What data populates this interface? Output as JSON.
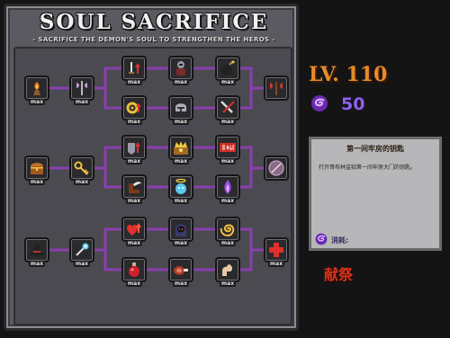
{
  "panel": {
    "title": "SOUL SACRIFICE",
    "subtitle": "- SACRIFICE THE DEMON'S SOUL TO STRENGTHEN THE HEROS -"
  },
  "tree": {
    "nodes": [
      {
        "id": "g1a",
        "icon": "brazier-icon",
        "badge": "max"
      },
      {
        "id": "g1b",
        "icon": "double-axe-icon",
        "badge": "max"
      },
      {
        "id": "g1c",
        "icon": "sword-up-icon",
        "badge": "max"
      },
      {
        "id": "g1d",
        "icon": "armored-knight-icon",
        "badge": "max"
      },
      {
        "id": "g1e",
        "icon": "bomb-icon",
        "badge": "max"
      },
      {
        "id": "g1f",
        "icon": "gear-up-icon",
        "badge": "max"
      },
      {
        "id": "g1g",
        "icon": "helmet-icon",
        "badge": "max"
      },
      {
        "id": "g1h",
        "icon": "crossed-blades-icon",
        "badge": "max"
      },
      {
        "id": "g1i",
        "icon": "battle-axe-icon",
        "badge": "max"
      },
      {
        "id": "g2a",
        "icon": "treasure-chest-icon",
        "badge": "max"
      },
      {
        "id": "g2b",
        "icon": "golden-key-icon",
        "badge": "max"
      },
      {
        "id": "g2c",
        "icon": "armor-up-icon",
        "badge": "max"
      },
      {
        "id": "g2d",
        "icon": "gold-crown-icon",
        "badge": "max"
      },
      {
        "id": "g2e",
        "icon": "sale-sign-icon",
        "badge": "max"
      },
      {
        "id": "g2f",
        "icon": "winged-boot-icon",
        "badge": "max"
      },
      {
        "id": "g2g",
        "icon": "angel-soul-icon",
        "badge": "max"
      },
      {
        "id": "g2h",
        "icon": "purple-flame-icon",
        "badge": "max"
      },
      {
        "id": "g2i",
        "icon": "round-shield-icon",
        "badge": ""
      },
      {
        "id": "g3a",
        "icon": "top-hat-icon",
        "badge": "max"
      },
      {
        "id": "g3b",
        "icon": "magic-wand-icon",
        "badge": "max"
      },
      {
        "id": "g3c",
        "icon": "heart-up-icon",
        "badge": "max"
      },
      {
        "id": "g3d",
        "icon": "hooded-ghoul-icon",
        "badge": "max"
      },
      {
        "id": "g3e",
        "icon": "yellow-spiral-icon",
        "badge": "max"
      },
      {
        "id": "g3f",
        "icon": "red-potion-icon",
        "badge": "max"
      },
      {
        "id": "g3g",
        "icon": "meat-icon",
        "badge": "max"
      },
      {
        "id": "g3h",
        "icon": "strong-arm-icon",
        "badge": "max"
      },
      {
        "id": "g3i",
        "icon": "red-cross-icon",
        "badge": "max"
      }
    ]
  },
  "stats": {
    "level": "LV. 110",
    "soul_count": "50"
  },
  "info": {
    "title": "第一间牢房的钥匙",
    "description": "打开哥布林监狱第一间牢房大门的钥匙。",
    "cost_label": "消耗:"
  },
  "actions": {
    "sacrifice_label": "献祭"
  },
  "colors": {
    "link": "#8a3fb0",
    "level_text": "#e88a2a",
    "soul_text": "#8f5ff0",
    "sacrifice_text": "#d6351c"
  }
}
